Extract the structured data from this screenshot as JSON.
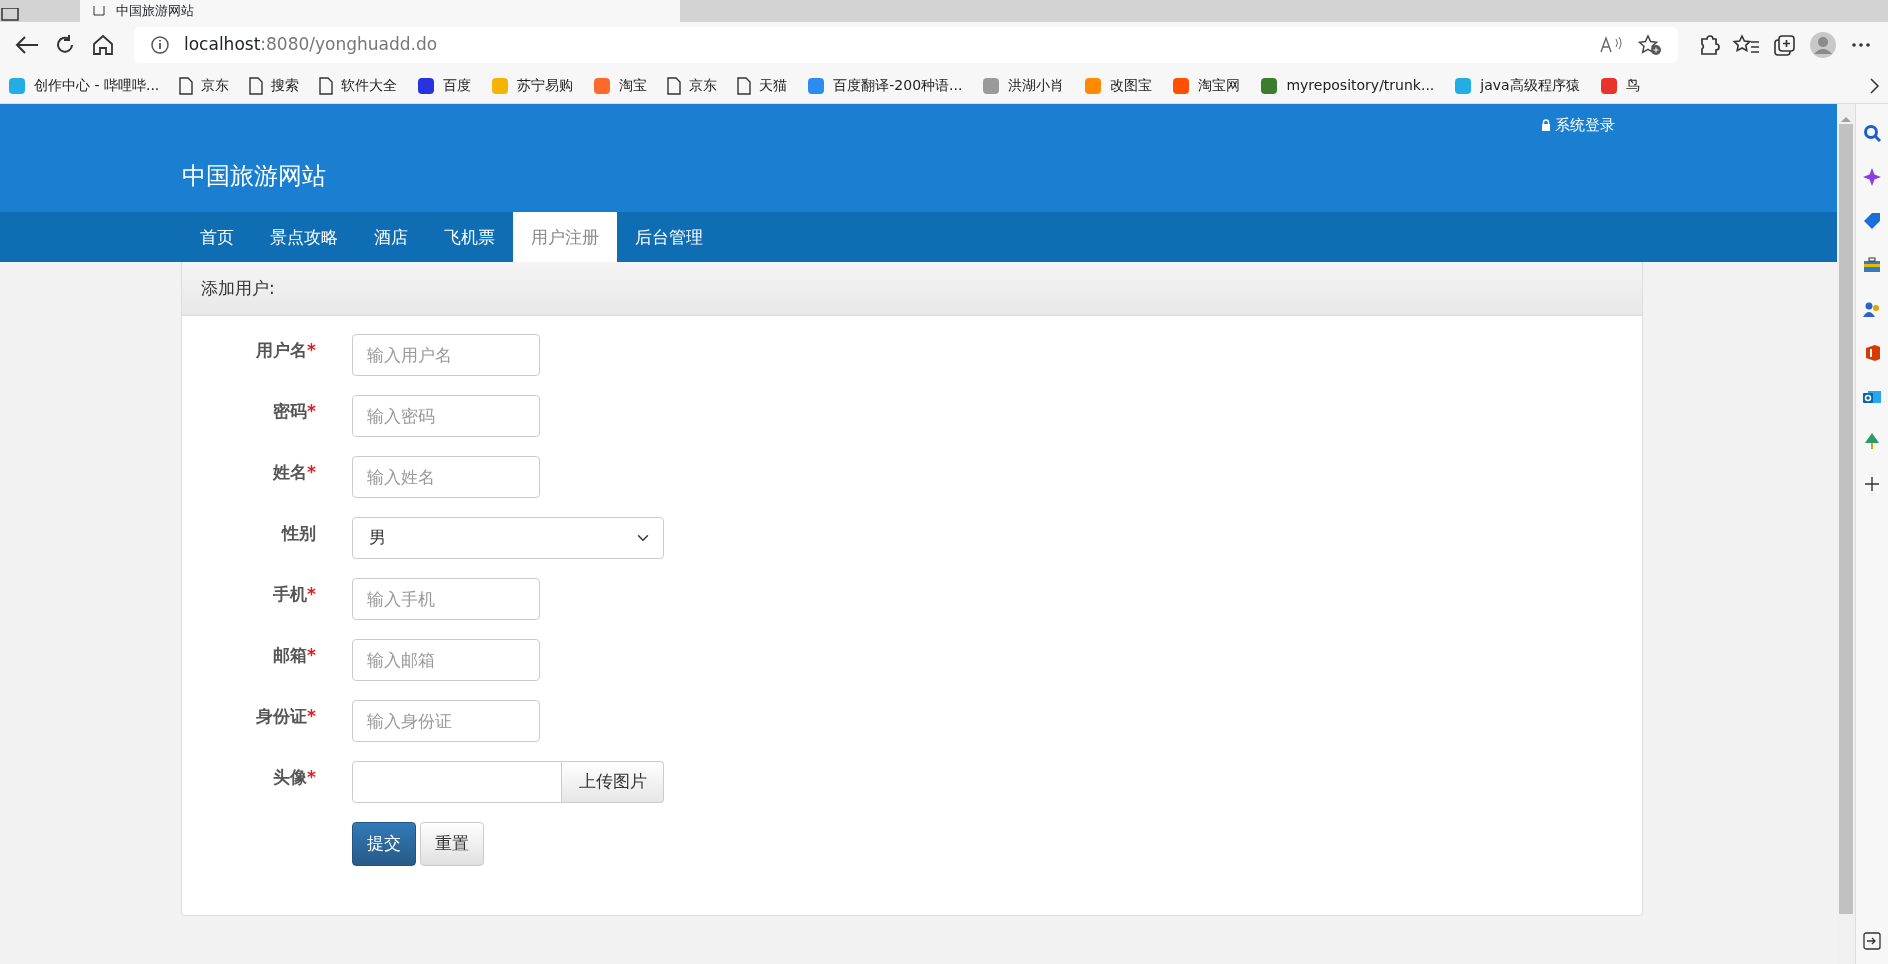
{
  "browser": {
    "tab_title": "中国旅游网站",
    "address_host": "localhost",
    "address_rest": ":8080/yonghuadd.do"
  },
  "bookmarks": [
    {
      "label": "创作中心 - 哔哩哔...",
      "kind": "site",
      "color": "#23ade5"
    },
    {
      "label": "京东",
      "kind": "page"
    },
    {
      "label": "搜索",
      "kind": "page"
    },
    {
      "label": "软件大全",
      "kind": "page"
    },
    {
      "label": "百度",
      "kind": "site",
      "color": "#2932e1"
    },
    {
      "label": "苏宁易购",
      "kind": "site",
      "color": "#f5b400"
    },
    {
      "label": "淘宝",
      "kind": "site",
      "color": "#ff6a2b"
    },
    {
      "label": "京东",
      "kind": "page"
    },
    {
      "label": "天猫",
      "kind": "page"
    },
    {
      "label": "百度翻译-200种语...",
      "kind": "site",
      "color": "#2d8cf0"
    },
    {
      "label": "洪湖小肖",
      "kind": "site",
      "color": "#9a9a9a"
    },
    {
      "label": "改图宝",
      "kind": "site",
      "color": "#ff8a00"
    },
    {
      "label": "淘宝网",
      "kind": "site",
      "color": "#ff5000"
    },
    {
      "label": "myrepository/trunk...",
      "kind": "site",
      "color": "#3a7d2c"
    },
    {
      "label": "java高级程序猿",
      "kind": "site",
      "color": "#23ade5"
    },
    {
      "label": "鸟",
      "kind": "site",
      "color": "#e8322a"
    }
  ],
  "header": {
    "login": "系统登录",
    "site_title": "中国旅游网站"
  },
  "nav": [
    {
      "label": "首页",
      "selected": false
    },
    {
      "label": "景点攻略",
      "selected": false
    },
    {
      "label": "酒店",
      "selected": false
    },
    {
      "label": "飞机票",
      "selected": false
    },
    {
      "label": "用户注册",
      "selected": true
    },
    {
      "label": "后台管理",
      "selected": false
    }
  ],
  "form": {
    "title": "添加用户:",
    "fields": [
      {
        "label": "用户名",
        "mark": "*",
        "kind": "text",
        "placeholder": "输入用户名"
      },
      {
        "label": "密码",
        "mark": "*",
        "kind": "text",
        "placeholder": "输入密码"
      },
      {
        "label": "姓名",
        "mark": "*",
        "kind": "text",
        "placeholder": "输入姓名"
      },
      {
        "label": "性别",
        "kind": "select",
        "value": "男"
      },
      {
        "label": "手机",
        "mark": "*",
        "kind": "text",
        "placeholder": "输入手机"
      },
      {
        "label": "邮箱",
        "mark": "*",
        "kind": "text",
        "placeholder": "输入邮箱"
      },
      {
        "label": "身份证",
        "mark": "*",
        "kind": "text",
        "placeholder": "输入身份证"
      },
      {
        "label": "头像",
        "mark": "*",
        "kind": "file",
        "button": "上传图片"
      }
    ],
    "buttons": [
      {
        "label": "提交",
        "kind": "primary"
      },
      {
        "label": "重置",
        "kind": "default"
      }
    ]
  }
}
